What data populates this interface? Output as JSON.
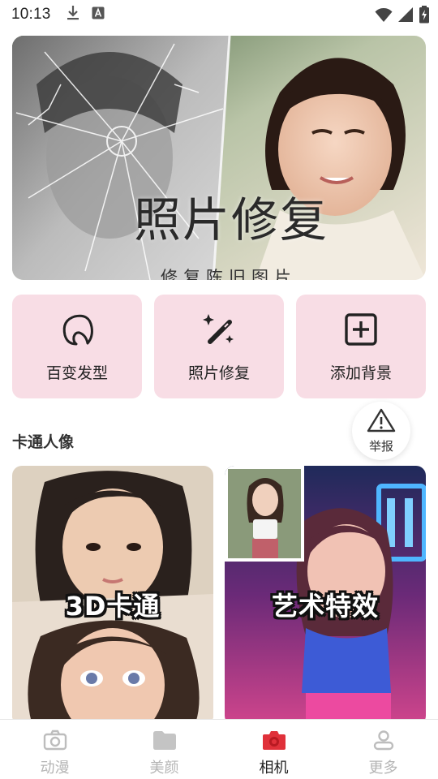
{
  "status_bar": {
    "time": "10:13",
    "icons": [
      "download-icon",
      "font-icon",
      "wifi-icon",
      "signal-icon",
      "battery-charging-icon"
    ]
  },
  "banner": {
    "title": "照片修复",
    "subtitle": "修复陈旧图片",
    "slide_count": 4,
    "active_slide": 3,
    "accent_color": "#e8466a"
  },
  "features": [
    {
      "label": "百变发型",
      "icon": "hairstyle-icon"
    },
    {
      "label": "照片修复",
      "icon": "magic-wand-icon"
    },
    {
      "label": "添加背景",
      "icon": "add-square-icon"
    }
  ],
  "features_bg_color": "#f8dde5",
  "section": {
    "title": "卡通人像"
  },
  "report": {
    "label": "举报",
    "icon": "warning-icon"
  },
  "cards": [
    {
      "caption": "3D卡通"
    },
    {
      "caption": "艺术特效"
    }
  ],
  "bottom_nav": [
    {
      "label": "动漫",
      "icon": "camera-icon",
      "active": false
    },
    {
      "label": "美颜",
      "icon": "folder-icon",
      "active": false
    },
    {
      "label": "相机",
      "icon": "camera-red-icon",
      "active": true
    },
    {
      "label": "更多",
      "icon": "person-icon",
      "active": false
    }
  ],
  "nav_active_color": "#e0313a"
}
